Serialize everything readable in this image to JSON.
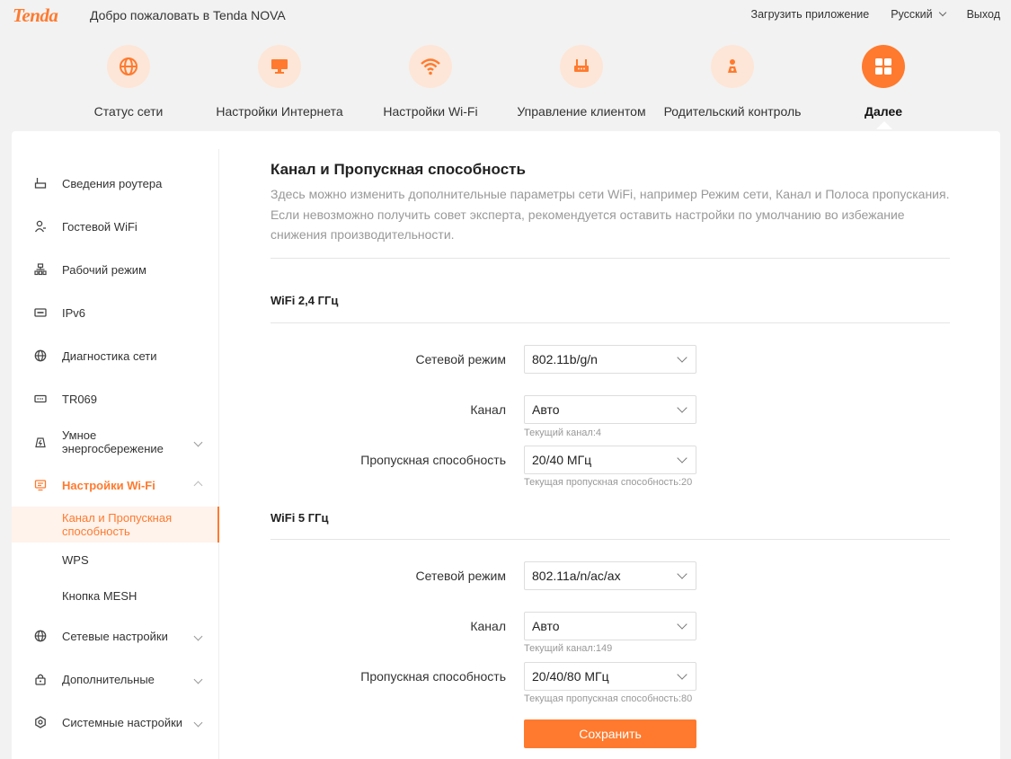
{
  "header": {
    "logo": "Tenda",
    "welcome": "Добро пожаловать в Tenda NOVA",
    "download_app": "Загрузить приложение",
    "language": "Русский",
    "logout": "Выход"
  },
  "nav": {
    "items": [
      {
        "label": "Статус сети",
        "icon": "globe-icon"
      },
      {
        "label": "Настройки Интернета",
        "icon": "monitor-icon"
      },
      {
        "label": "Настройки Wi-Fi",
        "icon": "wifi-icon"
      },
      {
        "label": "Управление клиентом",
        "icon": "router-icon"
      },
      {
        "label": "Родительский контроль",
        "icon": "parental-icon"
      },
      {
        "label": "Далее",
        "icon": "grid-icon"
      }
    ],
    "active_index": 5
  },
  "sidebar": {
    "items": [
      {
        "label": "Сведения роутера",
        "icon": "router-info-icon"
      },
      {
        "label": "Гостевой WiFi",
        "icon": "guest-icon"
      },
      {
        "label": "Рабочий режим",
        "icon": "topology-icon"
      },
      {
        "label": "IPv6",
        "icon": "ipv6-icon"
      },
      {
        "label": "Диагностика сети",
        "icon": "globe-icon"
      },
      {
        "label": "TR069",
        "icon": "tr069-icon"
      },
      {
        "label": "Умное энергосбережение",
        "icon": "energy-icon"
      },
      {
        "label": "Настройки Wi-Fi",
        "icon": "wifi-settings-icon"
      },
      {
        "label": "Сетевые настройки",
        "icon": "globe-icon"
      },
      {
        "label": "Дополнительные",
        "icon": "lock-icon"
      },
      {
        "label": "Системные настройки",
        "icon": "gear-icon"
      }
    ],
    "subitems": [
      {
        "label": "Канал и Пропускная способность"
      },
      {
        "label": "WPS"
      },
      {
        "label": "Кнопка MESH"
      }
    ]
  },
  "page": {
    "title": "Канал и Пропускная способность",
    "description": "Здесь можно изменить дополнительные параметры сети WiFi, например Режим сети, Канал и Полоса пропускания. Если невозможно получить совет эксперта, рекомендуется оставить настройки по умолчанию во избежание снижения производительности."
  },
  "wifi24": {
    "title": "WiFi 2,4 ГГц",
    "mode_label": "Сетевой режим",
    "mode_value": "802.11b/g/n",
    "channel_label": "Канал",
    "channel_value": "Авто",
    "channel_hint": "Текущий канал:4",
    "bw_label": "Пропускная способность",
    "bw_value": "20/40 МГц",
    "bw_hint": "Текущая пропускная способность:20"
  },
  "wifi5": {
    "title": "WiFi 5 ГГц",
    "mode_label": "Сетевой режим",
    "mode_value": "802.11a/n/ac/ax",
    "channel_label": "Канал",
    "channel_value": "Авто",
    "channel_hint": "Текущий канал:149",
    "bw_label": "Пропускная способность",
    "bw_value": "20/40/80 МГц",
    "bw_hint": "Текущая пропускная способность:80"
  },
  "actions": {
    "save": "Сохранить"
  },
  "colors": {
    "accent": "#ff7a2e",
    "accent_light": "#fde6d7"
  }
}
